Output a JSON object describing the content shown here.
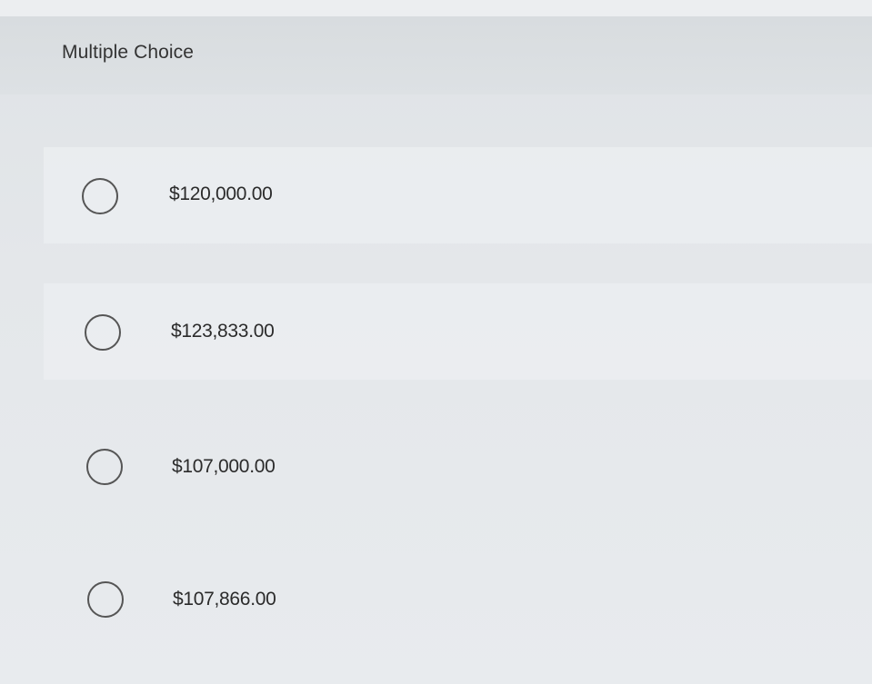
{
  "question": {
    "type_label": "Multiple Choice"
  },
  "options": [
    {
      "label": "$120,000.00"
    },
    {
      "label": "$123,833.00"
    },
    {
      "label": "$107,000.00"
    },
    {
      "label": "$107,866.00"
    }
  ],
  "colors": {
    "background": "#e4e7ea",
    "header": "#dadee1",
    "radio_border": "#555555",
    "text": "#2b2b2b"
  }
}
